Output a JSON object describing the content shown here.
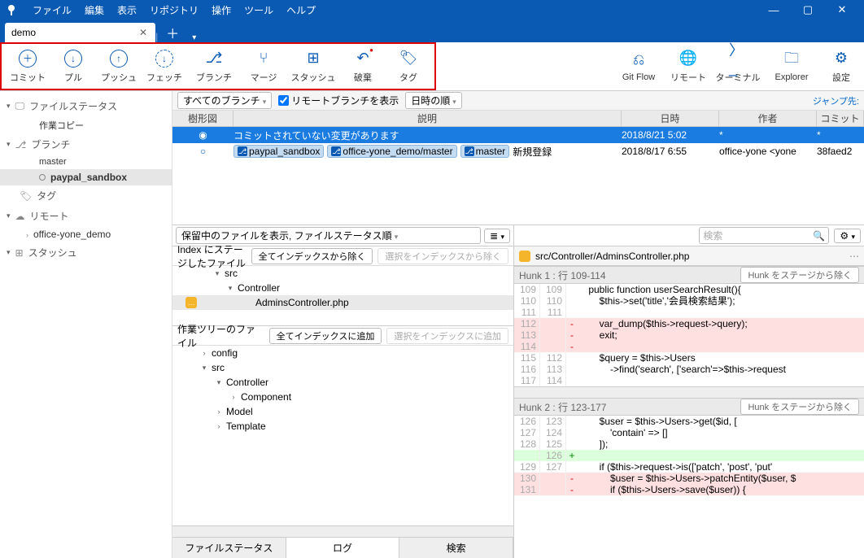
{
  "menu": {
    "file": "ファイル",
    "edit": "編集",
    "view": "表示",
    "repo": "リポジトリ",
    "action": "操作",
    "tool": "ツール",
    "help": "ヘルプ"
  },
  "tab": {
    "name": "demo"
  },
  "toolbar": {
    "commit": "コミット",
    "pull": "プル",
    "push": "プッシュ",
    "fetch": "フェッチ",
    "branch": "ブランチ",
    "merge": "マージ",
    "stash": "スタッシュ",
    "discard": "破棄",
    "tag": "タグ",
    "gitflow": "Git Flow",
    "remote": "リモート",
    "terminal": "ターミナル",
    "explorer": "Explorer",
    "settings": "設定"
  },
  "filter": {
    "all_branches": "すべてのブランチ",
    "show_remote": "リモートブランチを表示",
    "date_order": "日時の順",
    "jump": "ジャンプ先:"
  },
  "graph_headers": {
    "graph": "樹形図",
    "desc": "説明",
    "date": "日時",
    "author": "作者",
    "commit": "コミット"
  },
  "graph_rows": [
    {
      "desc": "コミットされていない変更があります",
      "date": "2018/8/21 5:02",
      "author": "*",
      "commit": "*",
      "selected": true
    },
    {
      "branches": [
        "paypal_sandbox",
        "office-yone_demo/master",
        "master"
      ],
      "desc": "新規登録",
      "date": "2018/8/17 6:55",
      "author": "office-yone <yone",
      "commit": "38faed2"
    }
  ],
  "sidebar": {
    "filestatus": {
      "label": "ファイルステータス",
      "items": [
        "作業コピー"
      ]
    },
    "branches": {
      "label": "ブランチ",
      "items": [
        "master",
        "paypal_sandbox"
      ],
      "selected": "paypal_sandbox"
    },
    "tags": {
      "label": "タグ"
    },
    "remotes": {
      "label": "リモート",
      "items": [
        "office-yone_demo"
      ]
    },
    "stashes": {
      "label": "スタッシュ"
    }
  },
  "fs": {
    "combo": "保留中のファイルを表示, ファイルステータス順",
    "staged": {
      "title": "Index にステージしたファイル",
      "unstage_all": "全てインデックスから除く",
      "unstage_sel": "選択をインデックスから除く"
    },
    "staged_tree": {
      "src": "src",
      "controller": "Controller",
      "file": "AdminsController.php"
    },
    "working": {
      "title": "作業ツリーのファイル",
      "stage_all": "全てインデックスに追加",
      "stage_sel": "選択をインデックスに追加"
    },
    "working_tree": {
      "config": "config",
      "src": "src",
      "controller": "Controller",
      "component": "Component",
      "model": "Model",
      "template": "Template"
    },
    "search_placeholder": "検索"
  },
  "diff": {
    "file": "src/Controller/AdminsController.php",
    "hunk1_label": "Hunk 1 : 行 109-114",
    "hunk2_label": "Hunk 2 : 行 123-177",
    "hunk_unstage": "Hunk をステージから除く",
    "lines1": [
      {
        "o": "109",
        "n": "109",
        "t": " ",
        "c": "    public function userSearchResult(){"
      },
      {
        "o": "110",
        "n": "110",
        "t": " ",
        "c": "        $this->set('title','会員検索結果');"
      },
      {
        "o": "111",
        "n": "111",
        "t": " ",
        "c": ""
      },
      {
        "o": "112",
        "n": "",
        "t": "-",
        "c": "        var_dump($this->request->query);"
      },
      {
        "o": "113",
        "n": "",
        "t": "-",
        "c": "        exit;"
      },
      {
        "o": "114",
        "n": "",
        "t": "-",
        "c": ""
      },
      {
        "o": "115",
        "n": "112",
        "t": " ",
        "c": "        $query = $this->Users"
      },
      {
        "o": "116",
        "n": "113",
        "t": " ",
        "c": "            ->find('search', ['search'=>$this->request"
      },
      {
        "o": "117",
        "n": "114",
        "t": " ",
        "c": ""
      }
    ],
    "lines2": [
      {
        "o": "126",
        "n": "123",
        "t": " ",
        "c": "        $user = $this->Users->get($id, ["
      },
      {
        "o": "127",
        "n": "124",
        "t": " ",
        "c": "            'contain' => []"
      },
      {
        "o": "128",
        "n": "125",
        "t": " ",
        "c": "        ]);"
      },
      {
        "o": "",
        "n": "126",
        "t": "+",
        "c": ""
      },
      {
        "o": "129",
        "n": "127",
        "t": " ",
        "c": "        if ($this->request->is(['patch', 'post', 'put'"
      },
      {
        "o": "130",
        "n": "",
        "t": "-",
        "c": "            $user = $this->Users->patchEntity($user, $"
      },
      {
        "o": "131",
        "n": "",
        "t": "-",
        "c": "            if ($this->Users->save($user)) {"
      }
    ]
  },
  "bottom_tabs": {
    "filestatus": "ファイルステータス",
    "log": "ログ",
    "search": "検索"
  }
}
